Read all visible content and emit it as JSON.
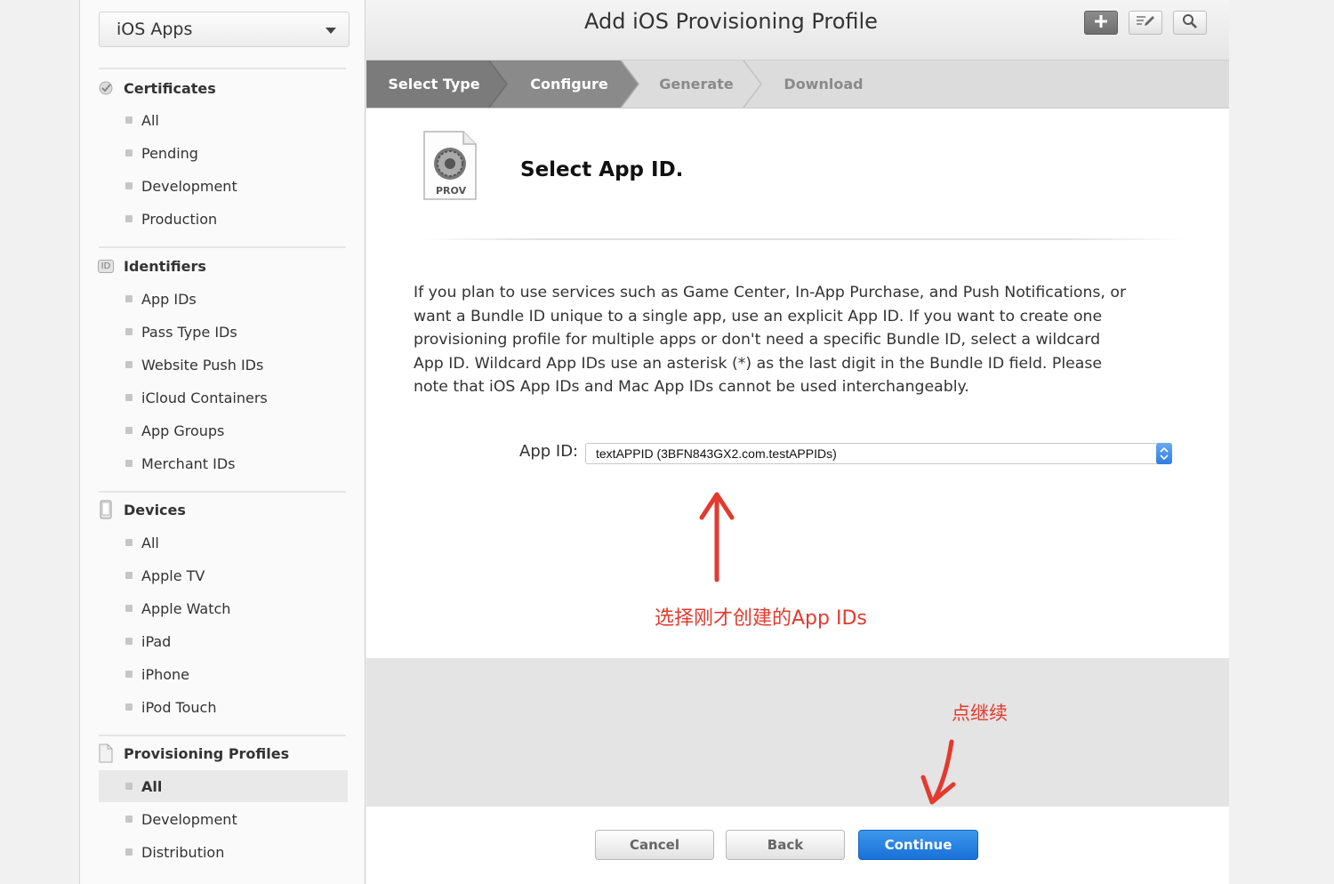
{
  "sidebar": {
    "platform": "iOS Apps",
    "sections": {
      "certificates": {
        "title": "Certificates",
        "items": [
          "All",
          "Pending",
          "Development",
          "Production"
        ]
      },
      "identifiers": {
        "title": "Identifiers",
        "icon_text": "ID",
        "items": [
          "App IDs",
          "Pass Type IDs",
          "Website Push IDs",
          "iCloud Containers",
          "App Groups",
          "Merchant IDs"
        ]
      },
      "devices": {
        "title": "Devices",
        "items": [
          "All",
          "Apple TV",
          "Apple Watch",
          "iPad",
          "iPhone",
          "iPod Touch"
        ]
      },
      "profiles": {
        "title": "Provisioning Profiles",
        "items": [
          "All",
          "Development",
          "Distribution"
        ],
        "selected": "All"
      }
    }
  },
  "header": {
    "title": "Add iOS Provisioning Profile",
    "icons": [
      "plus-icon",
      "edit-icon",
      "search-icon"
    ]
  },
  "steps": {
    "items": [
      "Select Type",
      "Configure",
      "Generate",
      "Download"
    ],
    "completed_count": 2
  },
  "content": {
    "file_icon_label": "PROV",
    "heading": "Select App ID.",
    "description": "If you plan to use services such as Game Center, In-App Purchase, and Push Notifications, or want a Bundle ID unique to a single app, use an explicit App ID. If you want to create one provisioning profile for multiple apps or don't need a specific Bundle ID, select a wildcard App ID. Wildcard App IDs use an asterisk (*) as the last digit in the Bundle ID field. Please note that iOS App IDs and Mac App IDs cannot be used interchangeably.",
    "app_id_label": "App ID:",
    "app_id_value": "textAPPID (3BFN843GX2.com.testAPPIDs)",
    "annotation_select": "选择刚才创建的App IDs",
    "annotation_continue": "点继续"
  },
  "footer": {
    "cancel": "Cancel",
    "back": "Back",
    "continue": "Continue"
  },
  "colors": {
    "accent": "#1970d8",
    "annotation": "#e23a2e",
    "step_done": "#7b7b7b",
    "step_todo": "#dcdcdc"
  }
}
